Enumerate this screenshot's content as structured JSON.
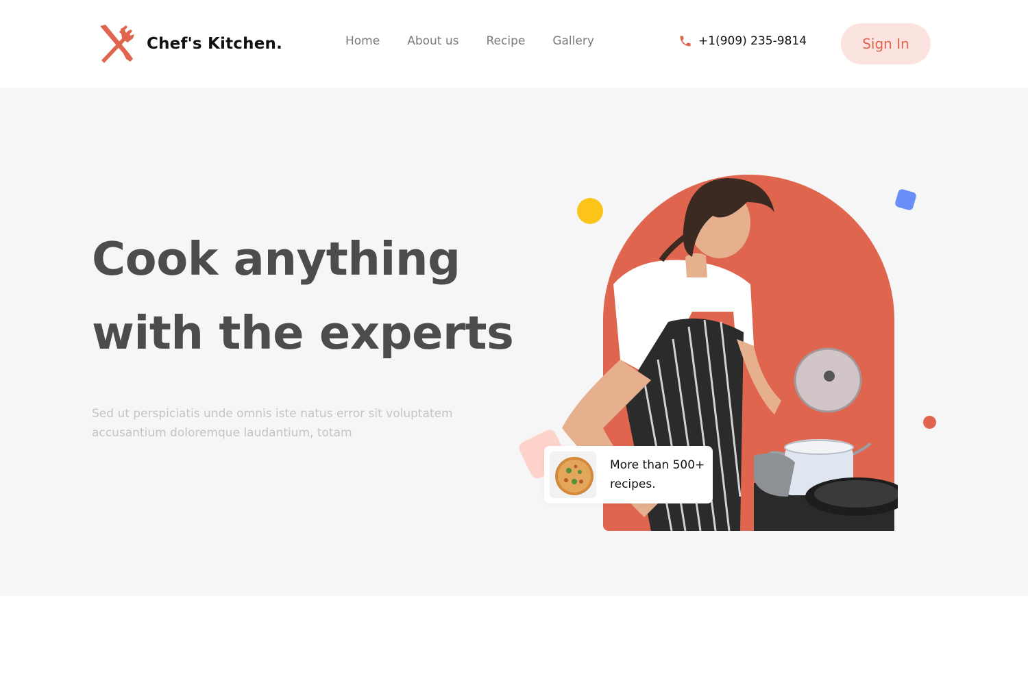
{
  "brand": {
    "name": "Chef's Kitchen.",
    "icon": "cutlery-icon",
    "accent": "#e0654e"
  },
  "nav": [
    {
      "label": "Home"
    },
    {
      "label": "About us"
    },
    {
      "label": "Recipe"
    },
    {
      "label": "Gallery"
    }
  ],
  "contact": {
    "phone": "+1(909) 235-9814",
    "icon": "phone-icon"
  },
  "header": {
    "signin_label": "Sign In"
  },
  "hero": {
    "headline": "Cook anything with the experts",
    "subtext": "Sed ut perspiciatis unde omnis iste natus error sit voluptatem accusantium doloremque laudantium, totam",
    "card_text": "More than 500+ recipes.",
    "card_icon": "pizza-image"
  },
  "colors": {
    "accent": "#e0654e",
    "signin_bg": "#fbe4df",
    "hero_bg": "#f6f6f6",
    "headline": "#4c4c4c",
    "subtext": "#c4c4c4",
    "yellow": "#fcc419",
    "blue": "#6a8ef7",
    "pink": "#fdd2ca"
  }
}
